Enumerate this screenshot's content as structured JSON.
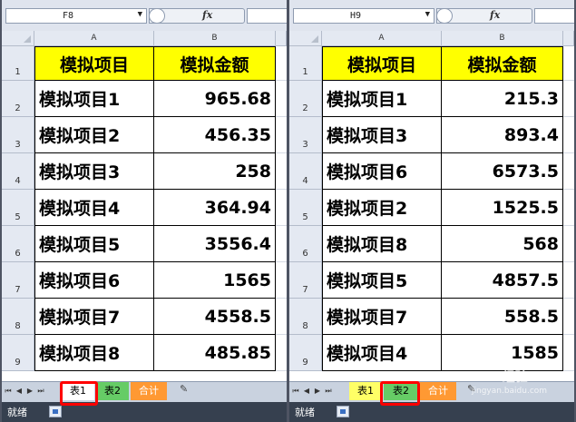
{
  "left": {
    "name_box": "F8",
    "fx": "fx",
    "columns": [
      "A",
      "B"
    ],
    "headers": [
      "模拟项目",
      "模拟金额"
    ],
    "rows": [
      {
        "num": "1"
      },
      {
        "num": "2",
        "item": "模拟项目1",
        "amount": "965.68"
      },
      {
        "num": "3",
        "item": "模拟项目2",
        "amount": "456.35"
      },
      {
        "num": "4",
        "item": "模拟项目3",
        "amount": "258"
      },
      {
        "num": "5",
        "item": "模拟项目4",
        "amount": "364.94"
      },
      {
        "num": "6",
        "item": "模拟项目5",
        "amount": "3556.4"
      },
      {
        "num": "7",
        "item": "模拟项目6",
        "amount": "1565"
      },
      {
        "num": "8",
        "item": "模拟项目7",
        "amount": "4558.5"
      },
      {
        "num": "9",
        "item": "模拟项目8",
        "amount": "485.85"
      }
    ],
    "tabs": [
      "表1",
      "表2",
      "合计"
    ],
    "active_tab": "表1",
    "status": "就绪"
  },
  "right": {
    "name_box": "H9",
    "fx": "fx",
    "columns": [
      "A",
      "B"
    ],
    "headers": [
      "模拟项目",
      "模拟金额"
    ],
    "rows": [
      {
        "num": "1"
      },
      {
        "num": "2",
        "item": "模拟项目1",
        "amount": "215.3"
      },
      {
        "num": "3",
        "item": "模拟项目3",
        "amount": "893.4"
      },
      {
        "num": "4",
        "item": "模拟项目6",
        "amount": "6573.5"
      },
      {
        "num": "5",
        "item": "模拟项目2",
        "amount": "1525.5"
      },
      {
        "num": "6",
        "item": "模拟项目8",
        "amount": "568"
      },
      {
        "num": "7",
        "item": "模拟项目5",
        "amount": "4857.5"
      },
      {
        "num": "8",
        "item": "模拟项目7",
        "amount": "558.5"
      },
      {
        "num": "9",
        "item": "模拟项目4",
        "amount": "1585"
      }
    ],
    "tabs": [
      "表1",
      "表2",
      "合计"
    ],
    "active_tab": "表2",
    "status": "就绪"
  },
  "watermark": {
    "text": "Bai 经验",
    "url": "jingyan.baidu.com"
  },
  "colors": {
    "header_fill": "#ffff00",
    "highlight": "#ff0000",
    "tab_green": "#66cc66",
    "tab_orange": "#ff9933"
  }
}
